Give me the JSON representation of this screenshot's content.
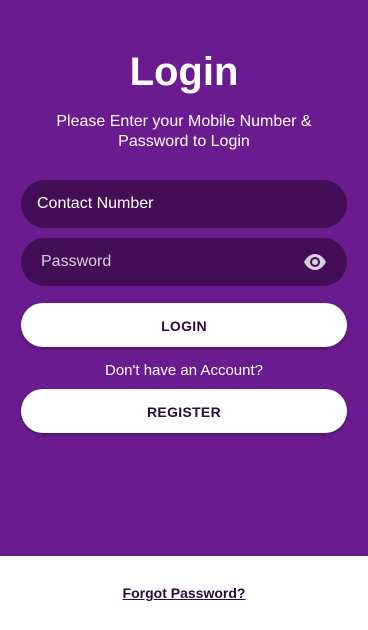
{
  "login": {
    "title": "Login",
    "subtitle": "Please Enter your Mobile Number & Password to Login",
    "contact_placeholder": "Contact Number",
    "password_placeholder": "Password",
    "password_toggle_icon": "eye-icon",
    "login_button": "LOGIN",
    "no_account_text": "Don't have an Account?",
    "register_button": "REGISTER",
    "forgot_password_link": "Forgot Password?"
  },
  "colors": {
    "background_purple": "#6a1b8f",
    "field_fill": "#440e57",
    "button_fill": "#ffffff",
    "button_text": "#2a0b36"
  }
}
